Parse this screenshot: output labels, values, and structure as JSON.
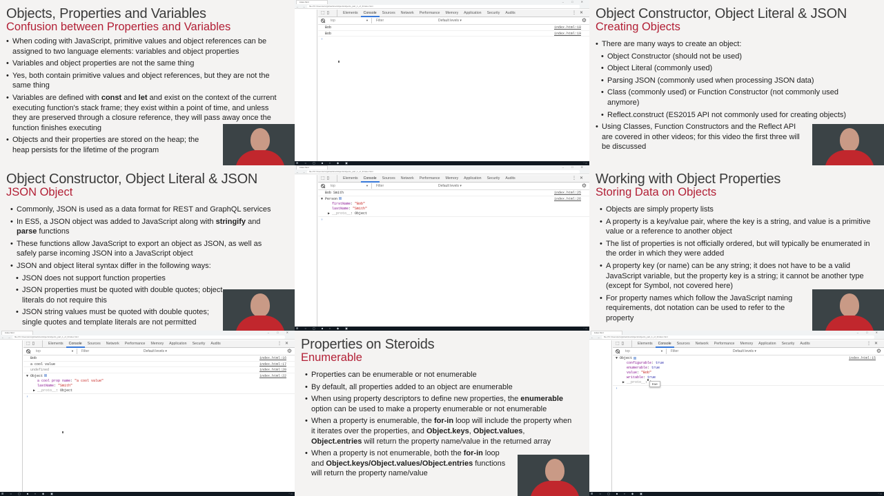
{
  "slides": {
    "s1": {
      "title": "Objects, Properties and Variables",
      "subtitle": "Confusion between Properties and Variables",
      "bullets": [
        "When coding with JavaScript, primitive values and object references can be assigned to two language elements: variables and object properties",
        "Variables and object properties are not the same thing",
        "Yes, both contain primitive values and object references, but they are not the same thing"
      ],
      "b4_pre": "Variables are defined with ",
      "b4_kw1": "const",
      "b4_mid": " and ",
      "b4_kw2": "let",
      "b4_post": " and exist on the context of the current executing function's stack frame; they exist within a point of time, and unless they are preserved through a closure reference, they will pass away once the function finishes executing",
      "b5": "Objects and their properties are stored on the heap; the heap persists for the lifetime of the program"
    },
    "s2": {
      "title": "Object Constructor, Object Literal & JSON",
      "subtitle": "Creating Objects",
      "bullets": [
        "There are many ways to create an object:",
        "Object Constructor (should not be used)",
        "Object Literal (commonly used)",
        "Parsing JSON (commonly used when processing JSON data)",
        "Class (commonly used) or Function Constructor (not commonly used anymore)",
        "Reflect.construct (ES2015 API not commonly used for creating objects)",
        "Using Classes, Function Constructors and the Reflect API are covered in other videos; for this video the first three will be discussed"
      ]
    },
    "s3": {
      "title": "Object Constructor, Object Literal & JSON",
      "subtitle": "JSON Object",
      "b1": "Commonly, JSON is used as a data format for REST and GraphQL services",
      "b2_pre": "In ES5, a JSON object was added to JavaScript along with ",
      "b2_kw1": "stringify",
      "b2_mid": " and ",
      "b2_kw2": "parse",
      "b2_post": " functions",
      "b3": "These functions allow JavaScript to export an object as JSON, as well as safely parse incoming JSON into a JavaScript object",
      "b4": "JSON and object literal syntax differ in the following ways:",
      "b5": "JSON does not support function properties",
      "b6": "JSON properties must be quoted with double quotes; object literals do not require this",
      "b7": "JSON string values must be quoted with double quotes; single quotes and template literals are not permitted"
    },
    "s4": {
      "title": "Working with Object Properties",
      "subtitle": "Storing Data on Objects",
      "bullets": [
        "Objects are simply property lists",
        "A property is a key/value pair, where the key is a string, and value is a primitive value or a reference to another object",
        "The list of properties is not officially ordered, but will typically be enumerated in the order in which they were added",
        "A property key (or name) can be any string; it does not have to be a valid JavaScript variable, but the property key is a string; it cannot be another type (except for Symbol, not covered here)",
        "For property names which follow the JavaScript naming requirements, dot notation can be used to refer to the property"
      ]
    },
    "s5": {
      "title": "Properties on Steroids",
      "subtitle": "Enumerable",
      "b1": "Properties can be enumerable or not enumerable",
      "b2": "By default, all properties added to an object are enumerable",
      "b3_pre": "When using property descriptors to define new properties, the ",
      "b3_kw": "enumerable",
      "b3_post": " option can be used to make a property enumerable or not enumerable",
      "b4_pre": "When a property is enumerable, the ",
      "b4_kw1": "for-in",
      "b4_mid": " loop will include the property when it iterates over the properties, and ",
      "b4_kw2": "Object.keys",
      "b4_sep": ", ",
      "b4_kw3": "Object.values",
      "b4_sep2": ", ",
      "b4_kw4": "Object.entries",
      "b4_post": " will return the property name/value in the returned array",
      "b5_pre": "When a property is not enumerable, both the ",
      "b5_kw1": "for-in",
      "b5_mid": " loop and ",
      "b5_kw2": "Object.keys/Object.values/Object.entries",
      "b5_post": " functions will return the property name/value"
    }
  },
  "browser": {
    "tab_title": "index.html",
    "url": "file:///C:/Users/eric/git/webinar/objects/objects_part_1_of_3/index.html",
    "devtools_tabs": [
      "Elements",
      "Console",
      "Sources",
      "Network",
      "Performance",
      "Memory",
      "Application",
      "Security",
      "Audits"
    ],
    "context": "top",
    "filter_placeholder": "Filter",
    "levels": "Default levels ▾"
  },
  "consoles": {
    "c1": {
      "rows": [
        {
          "text": "Bob",
          "src": "index.html:18"
        },
        {
          "text": "Bob",
          "src": "index.html:19"
        }
      ]
    },
    "c2": {
      "row1": {
        "text": "Bob Smith",
        "src": "index.html:25"
      },
      "obj": {
        "label": "Person",
        "src": "index.html:26"
      },
      "props": [
        {
          "key": "firstName",
          "val": "\"Bob\""
        },
        {
          "key": "lastName",
          "val": "\"Smith\""
        }
      ],
      "proto": "__proto__",
      "proto_val": ": Object"
    },
    "c3": {
      "rows": [
        {
          "text": "Bob",
          "src": "index.html:16"
        },
        {
          "text": "a cool value",
          "src": "index.html:17"
        },
        {
          "text": "undefined",
          "src": "index.html:20"
        }
      ],
      "obj": {
        "label": "Object",
        "src": "index.html:22"
      },
      "props": [
        {
          "key": "a cool prop name",
          "val": "\"a cool value\""
        },
        {
          "key": "lastName",
          "val": "\"Smith\""
        }
      ],
      "proto": "__proto__",
      "proto_val": ": Object"
    },
    "c4": {
      "obj": {
        "label": "Object",
        "src": "index.html:15"
      },
      "props": [
        {
          "key": "configurable",
          "val": "true"
        },
        {
          "key": "enumerable",
          "val": "true"
        },
        {
          "key": "value",
          "val": "\"Bob\""
        },
        {
          "key": "writable",
          "val": "true"
        }
      ],
      "proto": "__proto__",
      "proto_val": ": O",
      "tooltip": "true"
    }
  },
  "icons": {
    "inspect": "⬚",
    "device": "▯",
    "more": "⋮",
    "close": "✕",
    "gear": "⚙",
    "expanded": "▼",
    "collapsed": "▶",
    "prompt": "›",
    "nav": "← → ↻",
    "win": "– □ ✕",
    "taskbar": "⊞ ○ ▢ ■ ▪ ◆ ▣",
    "tray": "⌃ ▭"
  }
}
